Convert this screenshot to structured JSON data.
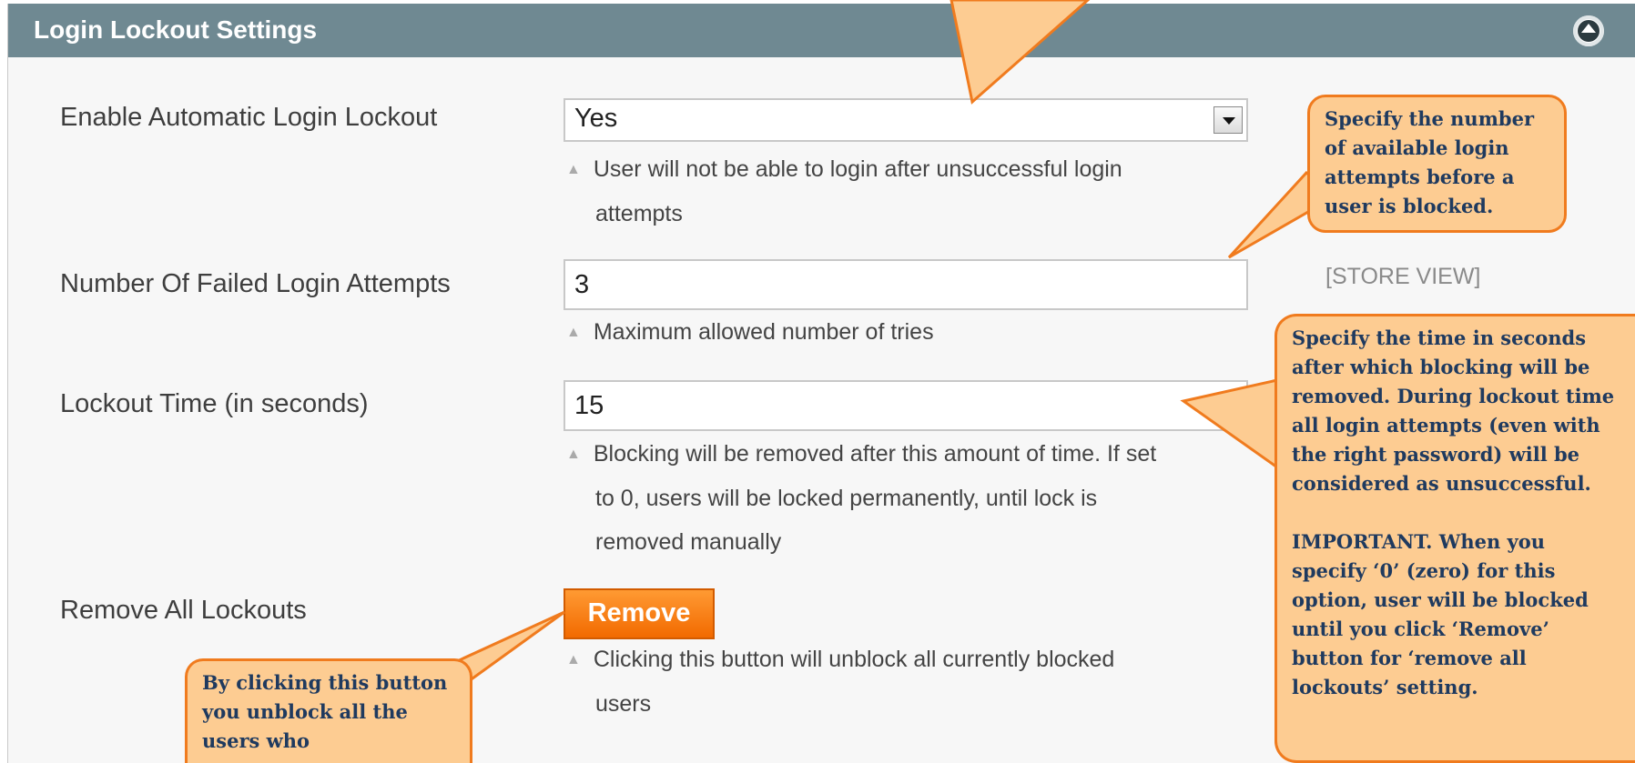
{
  "panel": {
    "title": "Login Lockout Settings"
  },
  "fields": [
    {
      "label": "Enable Automatic Login Lockout",
      "value": "Yes",
      "note_lines": [
        "User will not be able to login after unsuccessful login",
        "attempts"
      ]
    },
    {
      "label": "Number Of Failed Login Attempts",
      "value": "3",
      "scope": "[STORE VIEW]",
      "note_lines": [
        "Maximum allowed number of tries"
      ]
    },
    {
      "label": "Lockout Time (in seconds)",
      "value": "15",
      "note_lines": [
        "Blocking will be removed after this amount of time. If set",
        "to 0, users will be locked permanently, until lock is",
        "removed manually"
      ]
    },
    {
      "label": "Remove All Lockouts",
      "button_label": "Remove",
      "note_lines": [
        "Clicking this button will unblock all currently blocked",
        "users"
      ]
    }
  ],
  "callouts": {
    "attempts": "Specify the number of available login attempts before a user is blocked.",
    "lockout_time": "Specify the time in seconds after which blocking will be removed. During lockout time all login attempts (even with the right password) will be considered as unsuccessful.",
    "important": "IMPORTANT. When you specify ‘0’ (zero) for this option, user will be blocked until you click ‘Remove’ button for ‘remove all lockouts’ setting.",
    "remove": "By clicking this button you unblock all the users who"
  },
  "colors": {
    "header": "#6f8992",
    "callout_fill": "#fdcc92",
    "callout_border": "#f07b1e",
    "button": "#f26a00"
  }
}
